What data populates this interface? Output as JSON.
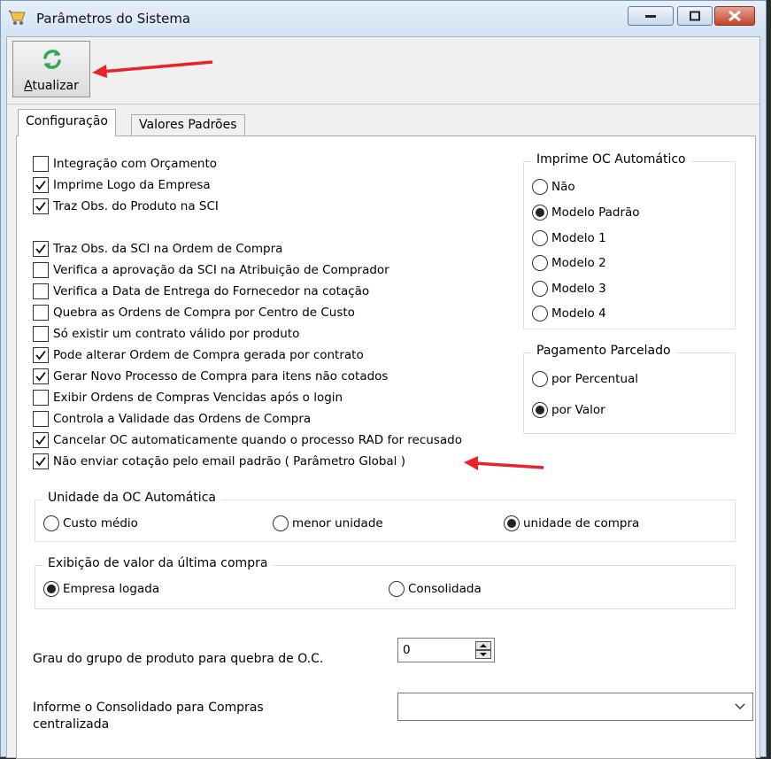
{
  "window": {
    "title": "Parâmetros do Sistema"
  },
  "toolbar": {
    "refresh_label_first": "A",
    "refresh_label_rest": "tualizar"
  },
  "tabs": [
    {
      "label": "Configuração",
      "active": true
    },
    {
      "label": "Valores Padrões",
      "active": false
    }
  ],
  "checkboxes": [
    {
      "label": "Integração com Orçamento",
      "checked": false
    },
    {
      "label": "Imprime Logo da Empresa",
      "checked": true
    },
    {
      "label": "Traz Obs. do Produto na SCI",
      "checked": true
    },
    {
      "label": "Traz Obs. da SCI na Ordem de Compra",
      "checked": true
    },
    {
      "label": "Verifica a aprovação da SCI na Atribuição de Comprador",
      "checked": false
    },
    {
      "label": "Verifica a Data de Entrega do Fornecedor na cotação",
      "checked": false
    },
    {
      "label": "Quebra as Ordens de Compra por Centro de Custo",
      "checked": false
    },
    {
      "label": "Só existir um contrato válido por produto",
      "checked": false
    },
    {
      "label": "Pode alterar Ordem de Compra gerada por contrato",
      "checked": true
    },
    {
      "label": "Gerar Novo Processo de Compra para itens não cotados",
      "checked": true
    },
    {
      "label": "Exibir Ordens de Compras Vencidas após o login",
      "checked": false
    },
    {
      "label": "Controla a Validade das Ordens de Compra",
      "checked": false
    },
    {
      "label": "Cancelar OC automaticamente quando o processo RAD for recusado",
      "checked": true
    },
    {
      "label": "Não enviar cotação pelo email padrão ( Parâmetro Global )",
      "checked": true
    }
  ],
  "imprime_oc": {
    "title": "Imprime OC Automático",
    "options": [
      {
        "label": "Não",
        "selected": false
      },
      {
        "label": "Modelo Padrão",
        "selected": true
      },
      {
        "label": "Modelo 1",
        "selected": false
      },
      {
        "label": "Modelo 2",
        "selected": false
      },
      {
        "label": "Modelo 3",
        "selected": false
      },
      {
        "label": "Modelo 4",
        "selected": false
      }
    ]
  },
  "pagamento": {
    "title": "Pagamento Parcelado",
    "options": [
      {
        "label": "por Percentual",
        "selected": false
      },
      {
        "label": "por Valor",
        "selected": true
      }
    ]
  },
  "unidade_oc": {
    "title": "Unidade da OC Automática",
    "options": [
      {
        "label": "Custo médio",
        "selected": false
      },
      {
        "label": "menor unidade",
        "selected": false
      },
      {
        "label": "unidade de compra",
        "selected": true
      }
    ]
  },
  "exibicao": {
    "title": "Exibição de valor da última compra",
    "options": [
      {
        "label": "Empresa logada",
        "selected": true
      },
      {
        "label": "Consolidada",
        "selected": false
      }
    ]
  },
  "grau": {
    "label": "Grau do grupo de produto para quebra de O.C.",
    "value": "0"
  },
  "consolidado": {
    "label_line1": "Informe o Consolidado para Compras",
    "label_line2": "centralizada",
    "value": ""
  },
  "colors": {
    "annotation_arrow": "#e8232a",
    "refresh_icon": "#2fa84f"
  }
}
